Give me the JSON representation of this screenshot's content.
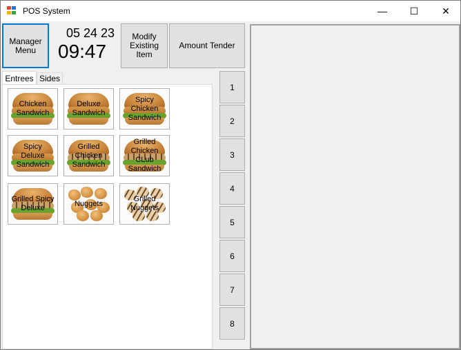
{
  "window": {
    "title": "POS System",
    "controls": {
      "minimize": "—",
      "maximize": "☐",
      "close": "✕"
    }
  },
  "header": {
    "manager_menu_label": "Manager\nMenu",
    "date": "05 24 23",
    "time": "09:47",
    "modify_label": "Modify\nExisting\nItem",
    "amount_tender_label": "Amount Tender"
  },
  "tabs": [
    {
      "label": "Entrees",
      "active": true
    },
    {
      "label": "Sides",
      "active": false
    }
  ],
  "entrees": [
    {
      "label": "Chicken\nSandwich",
      "kind": "sandwich"
    },
    {
      "label": "Deluxe\nSandwich",
      "kind": "sandwich"
    },
    {
      "label": "Spicy\nChicken\nSandwich",
      "kind": "sandwich"
    },
    {
      "label": "Spicy\nDeluxe\nSandwich",
      "kind": "sandwich"
    },
    {
      "label": "Grilled\nChicken\nSandwich",
      "kind": "grilled"
    },
    {
      "label": "Grilled\nChicken\nCLub\nSandwich",
      "kind": "grilled"
    },
    {
      "label": "Grilled Spicy\nDeluxe",
      "kind": "grilled"
    },
    {
      "label": "Nuggets",
      "kind": "nuggets"
    },
    {
      "label": "Grilled\nNuggets",
      "kind": "grilled-nuggets"
    }
  ],
  "numpad": [
    "1",
    "2",
    "3",
    "4",
    "5",
    "6",
    "7",
    "8"
  ],
  "colors": {
    "window_bg": "#f0f0f0",
    "focus_border": "#0078d7",
    "button_bg": "#e1e1e1"
  }
}
